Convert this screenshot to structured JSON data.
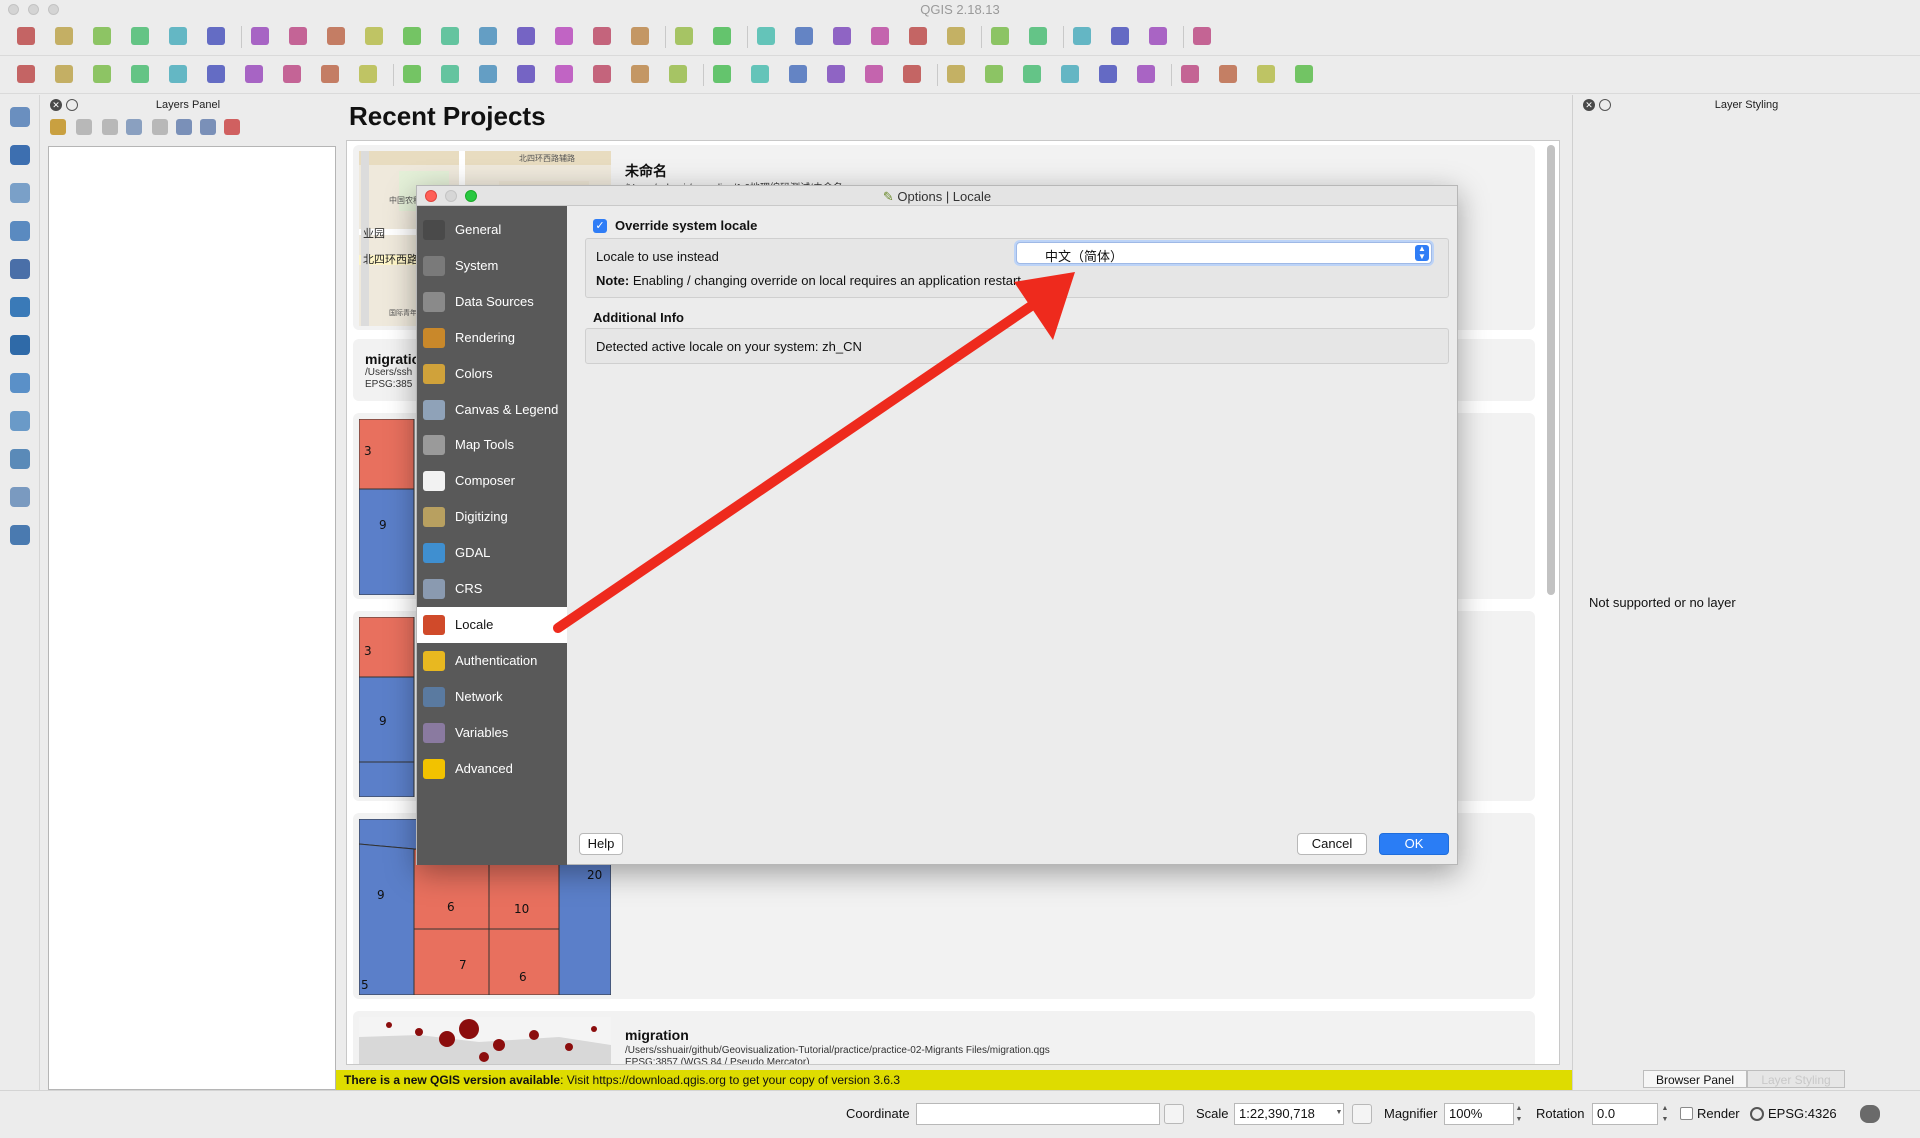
{
  "app": {
    "title": "QGIS 2.18.13"
  },
  "colors": {
    "accent": "#2a7df5",
    "message_bar": "#dedc00",
    "arrow": "#ee2a1d",
    "map_red": "#e8705e",
    "map_blue": "#5b7fc9"
  },
  "toolbar1_icons": [
    "new-project-icon",
    "open-project-icon",
    "save-project-icon",
    "save-as-icon",
    "new-print-composer-icon",
    "composer-manager-icon",
    "pan-icon",
    "pan-to-selection-icon",
    "zoom-in-icon",
    "zoom-out-icon",
    "zoom-actual-icon",
    "zoom-full-icon",
    "zoom-to-selection-icon",
    "zoom-to-layer-icon",
    "zoom-last-icon",
    "zoom-next-icon",
    "new-map-view-icon",
    "new-bookmark-icon",
    "refresh-icon",
    "identify-icon",
    "measure-icon",
    "select-features-icon",
    "select-by-value-icon",
    "deselect-icon",
    "attribute-table-icon",
    "field-calculator-icon",
    "statistics-icon",
    "map-tips-icon",
    "annotation-icon",
    "text-annotation-icon",
    "help-icon"
  ],
  "toolbar2_icons": [
    "current-edits-icon",
    "toggle-editing-icon",
    "save-edits-icon",
    "add-feature-icon",
    "move-feature-icon",
    "node-tool-icon",
    "delete-selected-icon",
    "cut-features-icon",
    "copy-features-icon",
    "paste-features-icon",
    "label-icon",
    "diagram-icon",
    "layer-labeling-icon",
    "pin-labels-icon",
    "show-labels-icon",
    "move-label-icon",
    "rotate-label-icon",
    "change-label-icon",
    "grass-icon",
    "plugin-icon",
    "raster-icon",
    "wms-icon",
    "wfs-icon",
    "database-icon",
    "csw-icon",
    "python-icon",
    "cloud-icon",
    "svg-icon",
    "circles-icon",
    "camera-icon",
    "crosshair-icon",
    "georef-icon",
    "topology-icon",
    "network-icon"
  ],
  "layers_panel": {
    "title": "Layers Panel"
  },
  "recent": {
    "title": "Recent Projects",
    "projects": [
      {
        "name": "未命名",
        "path": "/Users/sshuair/recording/1.0地理编码测试/未命名.qgs",
        "crs": "",
        "map_labels": [
          "北四环西路辅路",
          "中国农科",
          "业园",
          "北四环西路",
          "国际青年驿站"
        ]
      },
      {
        "name": "migratio",
        "path": "/Users/ssh",
        "crs": "EPSG:385"
      },
      {
        "name": "",
        "path": "",
        "crs": "",
        "map_labels": [
          "3",
          "9"
        ]
      },
      {
        "name": "",
        "path": "",
        "crs": "",
        "map_labels": [
          "3",
          "9"
        ]
      },
      {
        "name": "",
        "path": "",
        "crs": "",
        "map_labels": [
          "9",
          "6",
          "10",
          "7",
          "6",
          "5",
          "20"
        ]
      },
      {
        "name": "migration",
        "path": "/Users/sshuair/github/Geovisualization-Tutorial/practice/practice-02-Migrants Files/migration.qgs",
        "crs": "EPSG:3857 (WGS 84 / Pseudo Mercator)"
      }
    ]
  },
  "message_bar": {
    "bold": "There is a new QGIS version available",
    "text": ": Visit https://download.qgis.org to get your copy of version 3.6.3"
  },
  "styling_panel": {
    "title": "Layer Styling",
    "empty_text": "Not supported or no layer"
  },
  "dock_tabs": {
    "browser": "Browser Panel",
    "styling": "Layer Styling"
  },
  "statusbar": {
    "coordinate_label": "Coordinate",
    "coordinate_value": "",
    "scale_label": "Scale",
    "scale_value": "1:22,390,718",
    "magnifier_label": "Magnifier",
    "magnifier_value": "100%",
    "rotation_label": "Rotation",
    "rotation_value": "0.0",
    "render_label": "Render",
    "crs": "EPSG:4326"
  },
  "dialog": {
    "title": "Options | Locale",
    "nav": [
      {
        "label": "General",
        "icon": "tools-icon",
        "color": "#4a4a4a"
      },
      {
        "label": "System",
        "icon": "system-gear-icon",
        "color": "#7a7a7a"
      },
      {
        "label": "Data Sources",
        "icon": "table-icon",
        "color": "#8a8a8a"
      },
      {
        "label": "Rendering",
        "icon": "brush-icon",
        "color": "#c9882a"
      },
      {
        "label": "Colors",
        "icon": "palette-icon",
        "color": "#d0a23a"
      },
      {
        "label": "Canvas & Legend",
        "icon": "canvas-icon",
        "color": "#8fa2b8"
      },
      {
        "label": "Map Tools",
        "icon": "map-tools-icon",
        "color": "#9a9a9a"
      },
      {
        "label": "Composer",
        "icon": "composer-icon",
        "color": "#f2f2f2"
      },
      {
        "label": "Digitizing",
        "icon": "digitizing-icon",
        "color": "#b8a060"
      },
      {
        "label": "GDAL",
        "icon": "globe-icon",
        "color": "#3f8fd0"
      },
      {
        "label": "CRS",
        "icon": "crs-globe-icon",
        "color": "#8a9ab0"
      },
      {
        "label": "Locale",
        "icon": "locale-flag-icon",
        "color": "#d04a2a"
      },
      {
        "label": "Authentication",
        "icon": "lock-icon",
        "color": "#e8b820"
      },
      {
        "label": "Network",
        "icon": "network-icon",
        "color": "#5a7aa0"
      },
      {
        "label": "Variables",
        "icon": "variables-icon",
        "color": "#8a7aa0"
      },
      {
        "label": "Advanced",
        "icon": "warning-icon",
        "color": "#f2c200"
      }
    ],
    "active_index": 11,
    "override_label": "Override system locale",
    "override_checked": true,
    "locale_label": "Locale to use instead",
    "locale_value": "中文（简体）",
    "note_bold": "Note:",
    "note_text": " Enabling / changing override on local requires an application restart",
    "additional_title": "Additional Info",
    "detected_text": "Detected active locale on your system: zh_CN",
    "help_label": "Help",
    "cancel_label": "Cancel",
    "ok_label": "OK"
  }
}
